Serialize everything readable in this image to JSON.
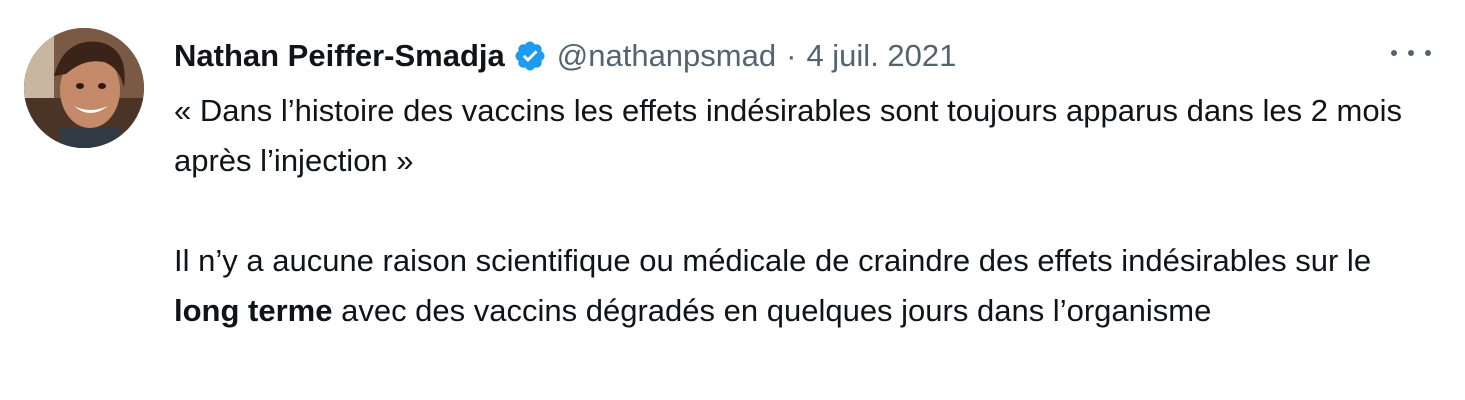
{
  "tweet": {
    "author_name": "Nathan Peiffer-Smadja",
    "handle": "@nathanpsmad",
    "separator": "·",
    "date": "4 juil. 2021",
    "verified_color": "#1d9bf0",
    "text_color": "#0f1419",
    "muted_color": "#536471",
    "paragraph1": "« Dans l’histoire des vaccins les effets indésirables sont toujours apparus dans les 2 mois après l’injection »",
    "paragraph2_part1": "Il n’y a aucune raison scientifique ou médicale de craindre des effets indésirables sur le ",
    "paragraph2_bold": "long terme",
    "paragraph2_part2": " avec des vaccins dégradés en quelques jours dans l’organisme",
    "icons": {
      "verified": "verified-badge-icon",
      "more": "more-horizontal-icon"
    }
  }
}
